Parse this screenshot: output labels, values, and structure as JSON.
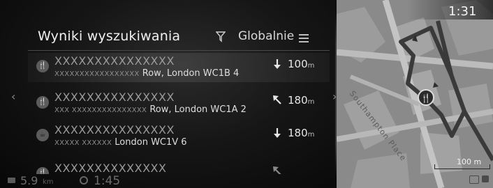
{
  "header": {
    "title": "Wyniki wyszukiwania",
    "scope_label": "Globalnie",
    "filter_icon": "filter-icon",
    "menu_icon": "list-menu-icon"
  },
  "results": [
    {
      "name": "XXXXXXXXXXXXXXX",
      "address_mask": "XXXXXXXXXXXXXXXXX",
      "address": "Row, London WC1B 4",
      "direction": "arrow-down",
      "distance": "100",
      "unit": "m"
    },
    {
      "name": "XXXXXXXXXXXXXXX",
      "address_mask": "XXX XXXXXXXXXXXXXXX",
      "address": "Row, London WC1A 2",
      "direction": "arrow-up-left",
      "distance": "180",
      "unit": "m"
    },
    {
      "name": "XXXXXXXXXXXXXXX",
      "address_mask": "XXXXX XXXXXX",
      "address": "London WC1V 6",
      "direction": "arrow-down",
      "distance": "180",
      "unit": "m"
    },
    {
      "name": "XXXXXXXXXXXXXX",
      "address_mask": "",
      "address": "",
      "direction": "arrow-up-left",
      "distance": "",
      "unit": ""
    }
  ],
  "status": {
    "odometer_value": "5.9",
    "odometer_unit": "km",
    "time_remaining": "1:45"
  },
  "map": {
    "clock": "1:31",
    "street_label": "Southampton Place",
    "scale_label": "100 m"
  },
  "colors": {
    "background": "#0b0b0b",
    "map_base": "#8e8e8e",
    "route": "#3a3a3a"
  }
}
